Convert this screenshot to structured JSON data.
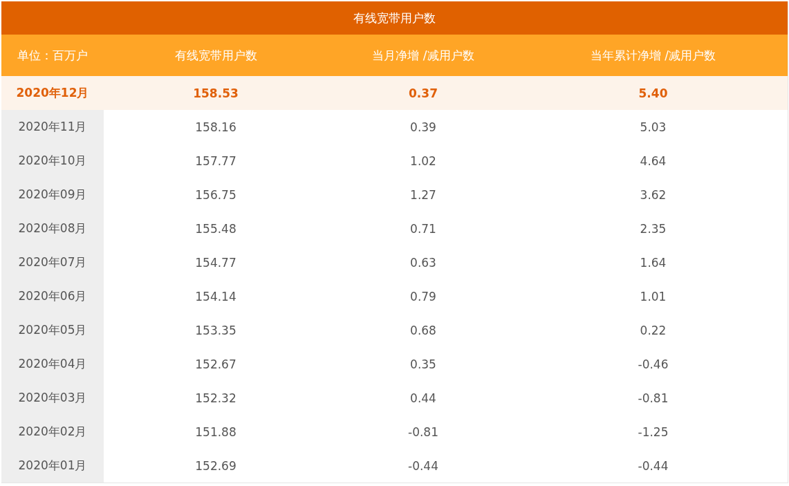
{
  "table": {
    "title": "有线宽带用户数",
    "columns": [
      "单位：百万户",
      "有线宽带用户数",
      "当月净增 /减用户数",
      "当年累计净增 /减用户数"
    ],
    "rows": [
      {
        "cells": [
          "2020年12月",
          "158.53",
          "0.37",
          "5.40"
        ],
        "selected": true
      },
      {
        "cells": [
          "2020年11月",
          "158.16",
          "0.39",
          "5.03"
        ],
        "selected": false
      },
      {
        "cells": [
          "2020年10月",
          "157.77",
          "1.02",
          "4.64"
        ],
        "selected": false
      },
      {
        "cells": [
          "2020年09月",
          "156.75",
          "1.27",
          "3.62"
        ],
        "selected": false
      },
      {
        "cells": [
          "2020年08月",
          "155.48",
          "0.71",
          "2.35"
        ],
        "selected": false
      },
      {
        "cells": [
          "2020年07月",
          "154.77",
          "0.63",
          "1.64"
        ],
        "selected": false
      },
      {
        "cells": [
          "2020年06月",
          "154.14",
          "0.79",
          "1.01"
        ],
        "selected": false
      },
      {
        "cells": [
          "2020年05月",
          "153.35",
          "0.68",
          "0.22"
        ],
        "selected": false
      },
      {
        "cells": [
          "2020年04月",
          "152.67",
          "0.35",
          "-0.46"
        ],
        "selected": false
      },
      {
        "cells": [
          "2020年03月",
          "152.32",
          "0.44",
          "-0.81"
        ],
        "selected": false
      },
      {
        "cells": [
          "2020年02月",
          "151.88",
          "-0.81",
          "-1.25"
        ],
        "selected": false
      },
      {
        "cells": [
          "2020年01月",
          "152.69",
          "-0.44",
          "-0.44"
        ],
        "selected": false
      }
    ]
  }
}
